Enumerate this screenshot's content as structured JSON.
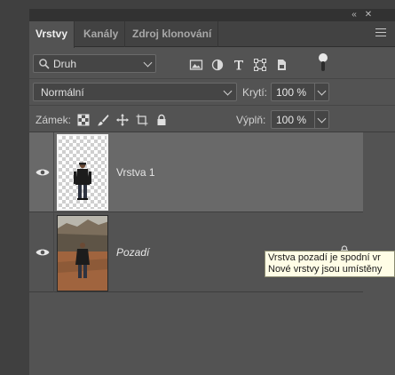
{
  "panel": {
    "collapse_glyph": "«",
    "close_glyph": "✕"
  },
  "tabs": [
    {
      "label": "Vrstvy",
      "active": true
    },
    {
      "label": "Kanály",
      "active": false
    },
    {
      "label": "Zdroj klonování",
      "active": false
    }
  ],
  "filter": {
    "selected": "Druh",
    "icons": [
      "image-filter-icon",
      "adjustment-filter-icon",
      "type-filter-icon",
      "shape-filter-icon",
      "smart-object-filter-icon"
    ]
  },
  "blend": {
    "mode": "Normální",
    "opacity_label": "Krytí:",
    "opacity_value": "100 %"
  },
  "lock": {
    "label": "Zámek:",
    "fill_label": "Výplň:",
    "fill_value": "100 %",
    "icons": [
      "lock-transparent-pixels-icon",
      "lock-image-pixels-icon",
      "lock-position-icon",
      "lock-artboard-icon",
      "lock-all-icon"
    ]
  },
  "layers": [
    {
      "name": "Vrstva 1",
      "selected": true,
      "visible": true,
      "italic": false,
      "locked": false
    },
    {
      "name": "Pozadí",
      "selected": false,
      "visible": true,
      "italic": true,
      "locked": true
    }
  ],
  "tooltip": {
    "line1": "Vrstva pozadí je spodní vr",
    "line2": "Nové vrstvy jsou umístěny"
  },
  "colors": {
    "panel_bg": "#535353",
    "selected_layer": "#696969",
    "tooltip_bg": "#fffde6"
  }
}
